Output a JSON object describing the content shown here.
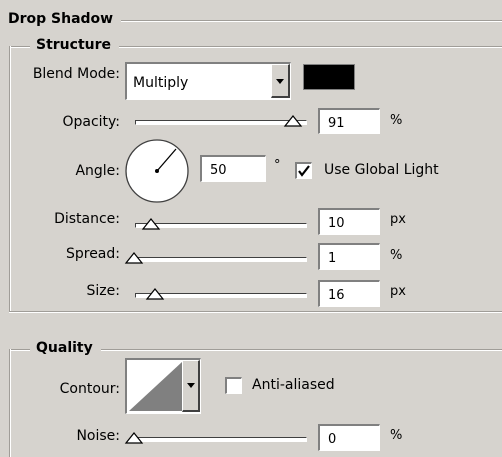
{
  "panel": {
    "title": "Drop Shadow"
  },
  "structure": {
    "title": "Structure",
    "blend_mode": {
      "label": "Blend Mode:",
      "value": "Multiply",
      "shadow_color": "#000000"
    },
    "opacity": {
      "label": "Opacity:",
      "value": "91",
      "unit": "%",
      "level": 0.91
    },
    "angle": {
      "label": "Angle:",
      "value": "50",
      "unit": "°",
      "degrees": 50
    },
    "global_light": {
      "label": "Use Global Light",
      "checked": true
    },
    "distance": {
      "label": "Distance:",
      "value": "10",
      "unit": "px",
      "level": 0.03
    },
    "spread": {
      "label": "Spread:",
      "value": "1",
      "unit": "%",
      "level": 0.01
    },
    "size": {
      "label": "Size:",
      "value": "16",
      "unit": "px",
      "level": 0.06
    }
  },
  "quality": {
    "title": "Quality",
    "contour": {
      "label": "Contour:"
    },
    "anti_aliased": {
      "label": "Anti-aliased",
      "checked": false
    },
    "noise": {
      "label": "Noise:",
      "value": "0",
      "unit": "%",
      "level": 0.0
    }
  }
}
